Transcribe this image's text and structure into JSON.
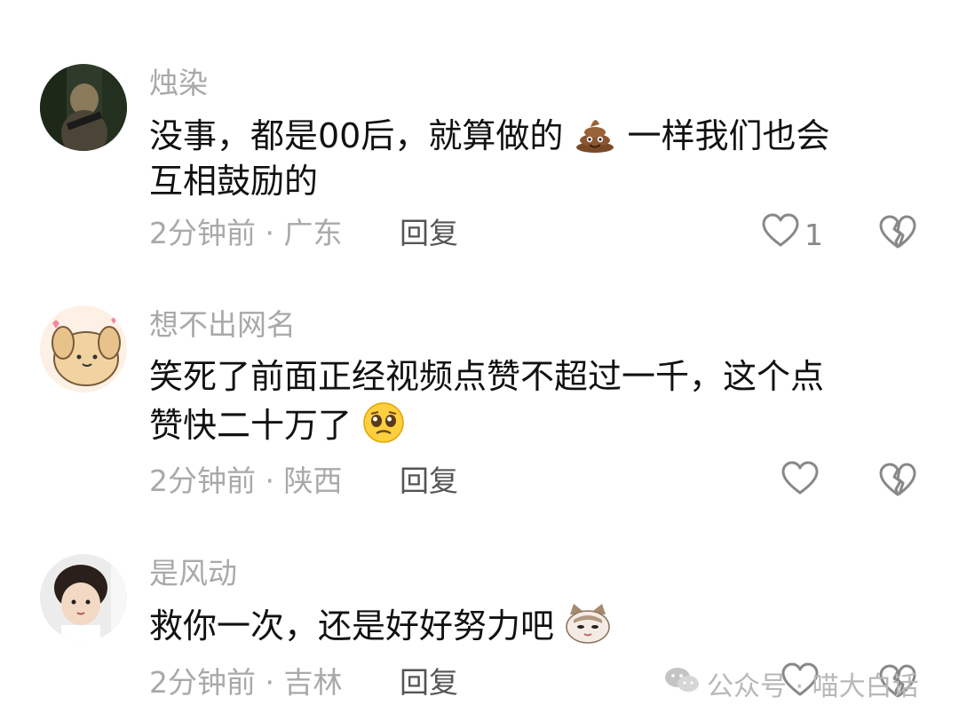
{
  "comments": [
    {
      "username": "烛染",
      "lines": [
        "没事，都是00后，就算做的",
        "一样我们也会",
        "互相鼓励的"
      ],
      "meta": "2分钟前 · 广东",
      "reply_label": "回复",
      "like_count": "1",
      "emoji": "poop-emoji"
    },
    {
      "username": "想不出网名",
      "lines": [
        "笑死了前面正经视频点赞不超过一千，这个点",
        "赞快二十万了"
      ],
      "meta": "2分钟前 · 陕西",
      "reply_label": "回复",
      "like_count": "",
      "emoji": "pleading-face-emoji"
    },
    {
      "username": "是风动",
      "lines": [
        "救你一次，还是好好努力吧"
      ],
      "meta": "2分钟前 · 吉林",
      "reply_label": "回复",
      "like_count": "",
      "emoji": "cat-face-emoji"
    }
  ],
  "watermark": {
    "text": "公众号 · 喵大白话",
    "icon": "wechat-icon"
  },
  "colors": {
    "text_primary": "#111111",
    "text_secondary": "#a9a9a9",
    "reply": "#555555",
    "background": "#ffffff"
  }
}
